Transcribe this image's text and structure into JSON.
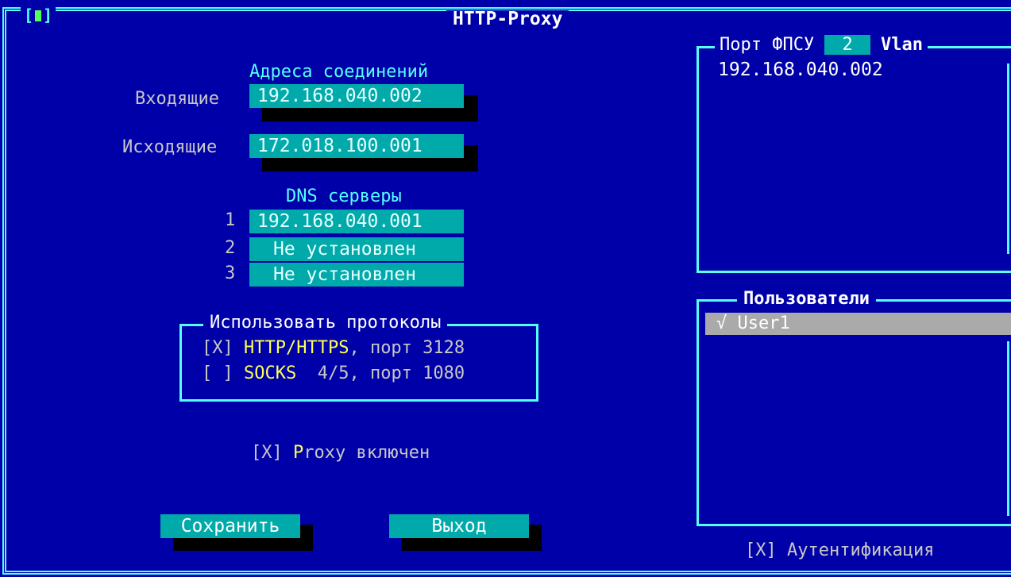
{
  "window": {
    "title": "HTTP-Proxy",
    "close_glyph_left": "[",
    "close_glyph_right": "]"
  },
  "connections": {
    "heading": "Адреса соединений",
    "incoming_label": "Входящие",
    "incoming_value": "192.168.040.002",
    "outgoing_label": "Исходящие",
    "outgoing_value": "172.018.100.001"
  },
  "dns": {
    "heading": "DNS серверы",
    "servers": [
      {
        "num": "1",
        "value": "192.168.040.001"
      },
      {
        "num": "2",
        "value": "Не установлен"
      },
      {
        "num": "3",
        "value": "Не установлен"
      }
    ]
  },
  "protocols": {
    "title": "Использовать протоколы",
    "http": {
      "check": "[X]",
      "name": "HTTP/HTTPS",
      "port_text": ", порт 3128"
    },
    "socks": {
      "check": "[ ]",
      "name": "SOCKS",
      "port_text": "  4/5, порт 1080"
    }
  },
  "proxy_enabled": {
    "check": "[X]",
    "hotkey": "P",
    "rest": "roxy включен"
  },
  "buttons": {
    "save": "Сохранить",
    "exit": "Выход"
  },
  "port_panel": {
    "title": "Порт ФПСУ",
    "port_value": "2",
    "vlan_label": "Vlan",
    "address": "192.168.040.002"
  },
  "users_panel": {
    "title": "Пользователи",
    "items": [
      {
        "mark": "√",
        "name": "User1"
      }
    ]
  },
  "auth": {
    "check": "[X]",
    "label": "Аутентификация"
  },
  "colors": {
    "background": "#0000a8",
    "frame": "#55ffff",
    "field": "#00aaaa",
    "highlight": "#ffff55",
    "selected_row": "#aaaaaa"
  }
}
